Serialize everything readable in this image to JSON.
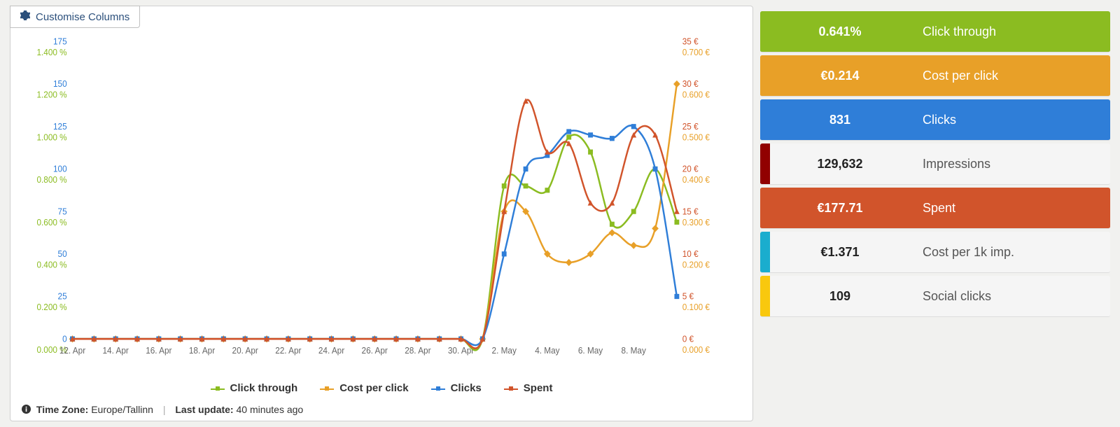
{
  "customise_label": "Customise Columns",
  "footer": {
    "tz_prefix": "Time Zone:",
    "tz_value": "Europe/Tallinn",
    "update_prefix": "Last update:",
    "update_value": "40 minutes ago"
  },
  "legend": [
    "Click through",
    "Cost per click",
    "Clicks",
    "Spent"
  ],
  "metrics": [
    {
      "value": "0.641%",
      "label": "Click through",
      "chip": "#8bbc21",
      "active": true,
      "bg": "#8bbc21"
    },
    {
      "value": "€0.214",
      "label": "Cost per click",
      "chip": "#e8a028",
      "active": true,
      "bg": "#e8a028"
    },
    {
      "value": "831",
      "label": "Clicks",
      "chip": "#2f7ed8",
      "active": true,
      "bg": "#2f7ed8"
    },
    {
      "value": "129,632",
      "label": "Impressions",
      "chip": "#910000",
      "active": false,
      "bg": "#f5f5f5"
    },
    {
      "value": "€177.71",
      "label": "Spent",
      "chip": "#d1542b",
      "active": true,
      "bg": "#d1542b"
    },
    {
      "value": "€1.371",
      "label": "Cost per 1k imp.",
      "chip": "#1aadce",
      "active": false,
      "bg": "#f5f5f5"
    },
    {
      "value": "109",
      "label": "Social clicks",
      "chip": "#f9c80e",
      "active": false,
      "bg": "#f5f5f5"
    }
  ],
  "chart_data": {
    "type": "line",
    "categories": [
      "12. Apr",
      "14. Apr",
      "16. Apr",
      "18. Apr",
      "20. Apr",
      "22. Apr",
      "24. Apr",
      "26. Apr",
      "28. Apr",
      "30. Apr",
      "2. May",
      "4. May",
      "6. May",
      "8. May"
    ],
    "axes": {
      "clicks": {
        "color": "#2f7ed8",
        "min": 0,
        "max": 175,
        "step": 25,
        "format": "{v}",
        "side": "left",
        "offset": 0
      },
      "click_through": {
        "color": "#8bbc21",
        "min": 0,
        "max": 1.4,
        "step": 0.2,
        "format": "{v} %",
        "side": "left",
        "offset": 1
      },
      "spent": {
        "color": "#d1542b",
        "min": 0,
        "max": 35,
        "step": 5,
        "format": "{v} €",
        "side": "right",
        "offset": 0
      },
      "cpc": {
        "color": "#e8a028",
        "min": 0,
        "max": 0.7,
        "step": 0.1,
        "format": "{v} €",
        "side": "right",
        "offset": 1
      }
    },
    "series": [
      {
        "name": "Click through",
        "axis": "click_through",
        "color": "#8bbc21",
        "marker": "square",
        "values": [
          0,
          0,
          0,
          0,
          0,
          0,
          0,
          0,
          0,
          0,
          0,
          0,
          0,
          0,
          0,
          0,
          0,
          0,
          0,
          0,
          0.72,
          0.72,
          0.7,
          0.95,
          0.88,
          0.54,
          0.6,
          0.8,
          0.55
        ]
      },
      {
        "name": "Cost per click",
        "axis": "cpc",
        "color": "#e8a028",
        "marker": "diamond",
        "values": [
          0,
          0,
          0,
          0,
          0,
          0,
          0,
          0,
          0,
          0,
          0,
          0,
          0,
          0,
          0,
          0,
          0,
          0,
          0,
          0,
          0.3,
          0.3,
          0.2,
          0.18,
          0.2,
          0.25,
          0.22,
          0.26,
          0.6
        ]
      },
      {
        "name": "Clicks",
        "axis": "clicks",
        "color": "#2f7ed8",
        "marker": "square",
        "values": [
          0,
          0,
          0,
          0,
          0,
          0,
          0,
          0,
          0,
          0,
          0,
          0,
          0,
          0,
          0,
          0,
          0,
          0,
          0,
          0,
          50,
          100,
          108,
          122,
          120,
          118,
          125,
          100,
          25
        ]
      },
      {
        "name": "Spent",
        "axis": "spent",
        "color": "#d1542b",
        "marker": "triangle",
        "values": [
          0,
          0,
          0,
          0,
          0,
          0,
          0,
          0,
          0,
          0,
          0,
          0,
          0,
          0,
          0,
          0,
          0,
          0,
          0,
          0,
          15,
          28,
          22,
          23,
          16,
          16,
          24,
          24,
          15
        ]
      }
    ]
  }
}
